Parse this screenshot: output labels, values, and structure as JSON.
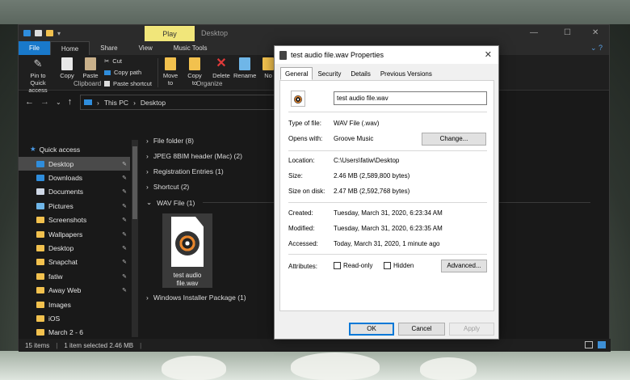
{
  "window": {
    "contextual_tab": "Play",
    "title": "Desktop",
    "controls": {
      "minimize": "—",
      "maximize": "☐",
      "close": "✕"
    }
  },
  "ribbon_tabs": [
    "File",
    "Home",
    "Share",
    "View",
    "Music Tools"
  ],
  "ribbon": {
    "pin_label": "Pin to Quick access",
    "copy_label": "Copy",
    "paste_label": "Paste",
    "cut_label": "Cut",
    "copy_path_label": "Copy path",
    "paste_shortcut_label": "Paste shortcut",
    "clipboard_group": "Clipboard",
    "move_to_label": "Move to",
    "copy_to_label": "Copy to",
    "delete_label": "Delete",
    "rename_label": "Rename",
    "new_folder_label": "No",
    "organize_group": "Organize"
  },
  "address": {
    "root": "This PC",
    "folder": "Desktop"
  },
  "sidebar": {
    "quick_access": "Quick access",
    "items": [
      {
        "label": "Desktop",
        "icon": "desktop-icon",
        "color": "#2f8ddc",
        "pinned": true,
        "selected": true
      },
      {
        "label": "Downloads",
        "icon": "download-icon",
        "color": "#2f8ddc",
        "pinned": true
      },
      {
        "label": "Documents",
        "icon": "documents-icon",
        "color": "#cfd8e6",
        "pinned": true
      },
      {
        "label": "Pictures",
        "icon": "pictures-icon",
        "color": "#6fb6e8",
        "pinned": true
      },
      {
        "label": "Screenshots",
        "icon": "folder-icon",
        "color": "#f2c14e",
        "pinned": true
      },
      {
        "label": "Wallpapers",
        "icon": "folder-icon",
        "color": "#f2c14e",
        "pinned": true
      },
      {
        "label": "Desktop",
        "icon": "folder-icon",
        "color": "#f2c14e",
        "pinned": true
      },
      {
        "label": "Snapchat",
        "icon": "folder-icon",
        "color": "#f2c14e",
        "pinned": true
      },
      {
        "label": "fatiw",
        "icon": "folder-icon",
        "color": "#f2c14e",
        "pinned": true
      },
      {
        "label": "Away Web",
        "icon": "folder-icon",
        "color": "#f2c14e",
        "pinned": true
      },
      {
        "label": "Images",
        "icon": "folder-icon",
        "color": "#f2c14e",
        "pinned": false
      },
      {
        "label": "iOS",
        "icon": "folder-icon",
        "color": "#f2c14e",
        "pinned": false
      },
      {
        "label": "March 2 - 6",
        "icon": "folder-icon",
        "color": "#f2c14e",
        "pinned": false
      }
    ]
  },
  "groups": [
    "File folder (8)",
    "JPEG 8BIM header (Mac) (2)",
    "Registration Entries (1)",
    "Shortcut (2)",
    "WAV File (1)",
    "Windows Installer Package (1)"
  ],
  "selected_file": {
    "line1": "test audio",
    "line2": "file.wav"
  },
  "status": {
    "count": "15 items",
    "selected": "1 item selected  2.46 MB"
  },
  "dialog": {
    "title": "test audio file.wav Properties",
    "tabs": [
      "General",
      "Security",
      "Details",
      "Previous Versions"
    ],
    "filename": "test audio file.wav",
    "type_label": "Type of file:",
    "type_value": "WAV File (.wav)",
    "opens_label": "Opens with:",
    "opens_value": "Groove Music",
    "change_btn": "Change...",
    "location_label": "Location:",
    "location_value": "C:\\Users\\fatiw\\Desktop",
    "size_label": "Size:",
    "size_value": "2.46 MB (2,589,800 bytes)",
    "size_disk_label": "Size on disk:",
    "size_disk_value": "2.47 MB (2,592,768 bytes)",
    "created_label": "Created:",
    "created_value": "Tuesday, March 31, 2020, 6:23:34 AM",
    "modified_label": "Modified:",
    "modified_value": "Tuesday, March 31, 2020, 6:23:35 AM",
    "accessed_label": "Accessed:",
    "accessed_value": "Today, March 31, 2020, 1 minute ago",
    "attributes_label": "Attributes:",
    "readonly_label": "Read-only",
    "hidden_label": "Hidden",
    "advanced_btn": "Advanced...",
    "ok_btn": "OK",
    "cancel_btn": "Cancel",
    "apply_btn": "Apply"
  },
  "colors": {
    "accent": "#1979ca",
    "play_tab": "#f1e67a",
    "folder": "#f2c14e"
  }
}
